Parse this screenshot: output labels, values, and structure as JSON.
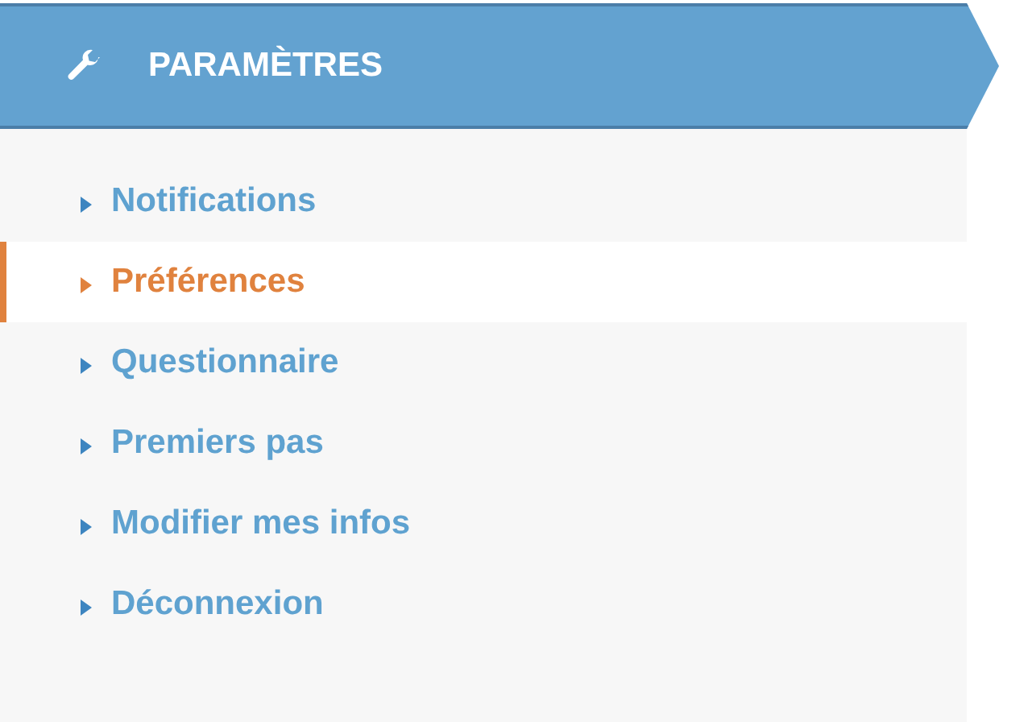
{
  "header": {
    "title": "PARAMÈTRES"
  },
  "menu": [
    {
      "label": "Notifications",
      "selected": false
    },
    {
      "label": "Préférences",
      "selected": true
    },
    {
      "label": "Questionnaire",
      "selected": false
    },
    {
      "label": "Premiers pas",
      "selected": false
    },
    {
      "label": "Modifier mes infos",
      "selected": false
    },
    {
      "label": "Déconnexion",
      "selected": false
    }
  ]
}
